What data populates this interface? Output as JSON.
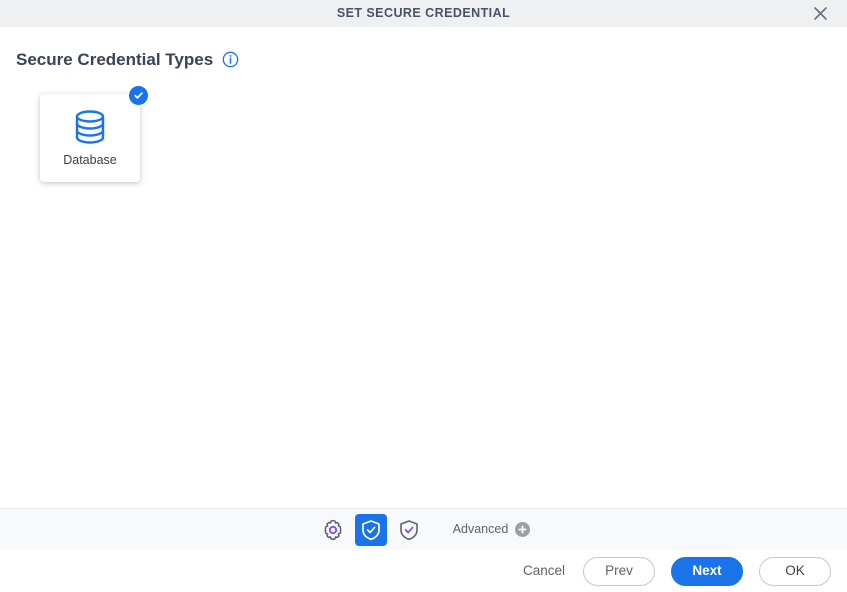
{
  "titlebar": {
    "title": "SET SECURE CREDENTIAL",
    "close_icon": "close-icon"
  },
  "main": {
    "section_title": "Secure Credential Types",
    "info_icon": "info-circle-icon",
    "cards": [
      {
        "label": "Database",
        "icon": "database-icon",
        "selected": true,
        "badge_icon": "check-circle-icon"
      }
    ]
  },
  "toolbar": {
    "items": [
      {
        "icon": "gear-icon",
        "selected": false
      },
      {
        "icon": "shield-check-filled-icon",
        "selected": true
      },
      {
        "icon": "shield-check-outline-icon",
        "selected": false
      }
    ],
    "advanced_label": "Advanced",
    "advanced_add_icon": "plus-circle-icon"
  },
  "footer": {
    "cancel_label": "Cancel",
    "prev_label": "Prev",
    "next_label": "Next",
    "ok_label": "OK"
  },
  "colors": {
    "accent": "#1a73e8",
    "titlebar_bg": "#eff0f2",
    "toolbar_bg": "#f8f9fb",
    "title_text": "#4a5264",
    "muted_text": "#5f6368",
    "icon_purple": "#7c4dff"
  }
}
